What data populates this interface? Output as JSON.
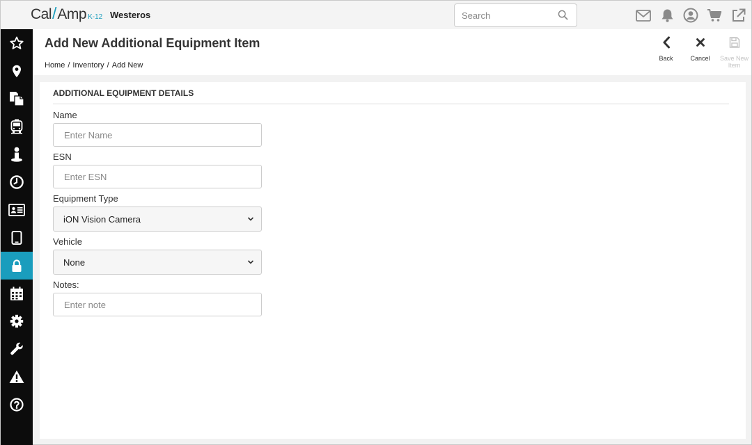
{
  "brand": {
    "name_left": "Cal",
    "name_right": "Amp",
    "suffix": "K-12",
    "accent": "#1a9dbd"
  },
  "org_name": "Westeros",
  "search": {
    "placeholder": "Search",
    "value": ""
  },
  "top_icons": [
    "mail-icon",
    "bell-icon",
    "user-icon",
    "cart-icon",
    "external-link-icon"
  ],
  "sidebar": {
    "active_index": 8,
    "items": [
      "star-icon",
      "location-pin-icon",
      "documents-icon",
      "bus-icon",
      "person-icon",
      "clock-icon",
      "id-card-icon",
      "tablet-icon",
      "lock-icon",
      "calendar-icon",
      "gear-icon",
      "wrench-icon",
      "warning-icon",
      "help-icon"
    ]
  },
  "page": {
    "title": "Add New Additional Equipment Item",
    "breadcrumb": [
      "Home",
      "Inventory",
      "Add New"
    ],
    "breadcrumb_sep": "/"
  },
  "actions": {
    "back": "Back",
    "cancel": "Cancel",
    "save_line1": "Save New",
    "save_line2": "Item"
  },
  "form": {
    "section_title": "ADDITIONAL EQUIPMENT DETAILS",
    "name": {
      "label": "Name",
      "placeholder": "Enter Name",
      "value": ""
    },
    "esn": {
      "label": "ESN",
      "placeholder": "Enter ESN",
      "value": ""
    },
    "equipment_type": {
      "label": "Equipment Type",
      "selected": "iON Vision Camera"
    },
    "vehicle": {
      "label": "Vehicle",
      "selected": "None"
    },
    "notes": {
      "label": "Notes:",
      "placeholder": "Enter note",
      "value": ""
    }
  }
}
